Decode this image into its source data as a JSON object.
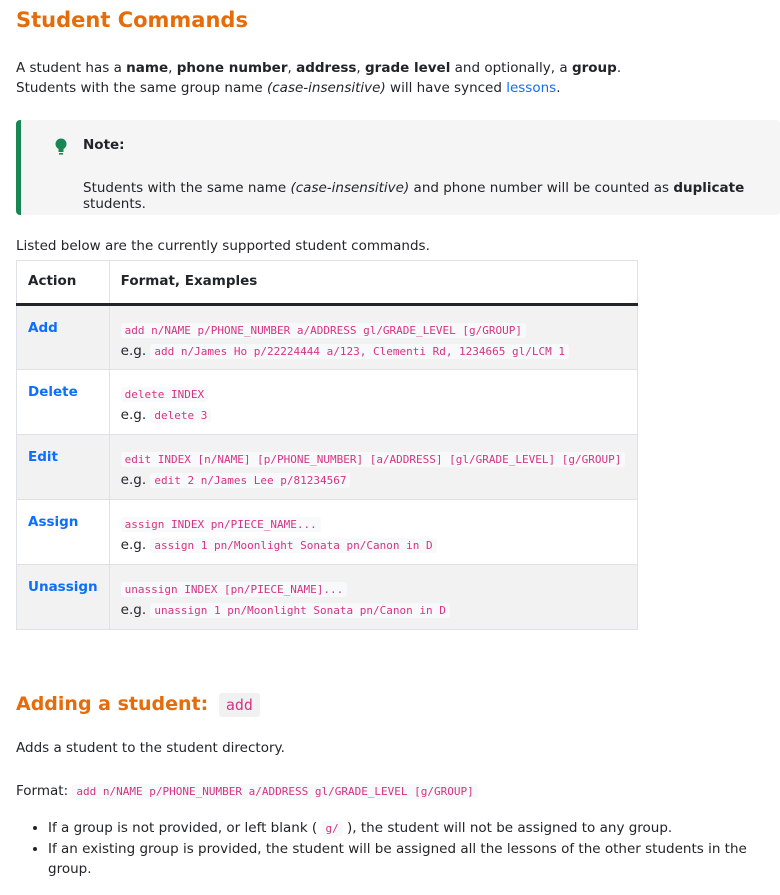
{
  "title": "Student Commands",
  "intro": {
    "p1_a": "A student has a ",
    "p1_name": "name",
    "p1_sep1": ", ",
    "p1_phone": "phone number",
    "p1_sep2": ", ",
    "p1_address": "address",
    "p1_sep3": ", ",
    "p1_grade": "grade level",
    "p1_b": " and optionally, a ",
    "p1_group": "group",
    "p1_c": ".",
    "p2_a": "Students with the same group name ",
    "p2_case": "(case-insensitive)",
    "p2_b": " will have synced ",
    "p2_link": "lessons",
    "p2_c": "."
  },
  "note": {
    "label": "Note:",
    "body_a": "Students with the same name ",
    "body_case": "(case-insensitive)",
    "body_b": " and phone number will be counted as ",
    "body_dup": "duplicate",
    "body_c": " students.",
    "icon_color": "#198754"
  },
  "listed_text": "Listed below are the currently supported student commands.",
  "table": {
    "headers": [
      "Action",
      "Format, Examples"
    ],
    "eg": "e.g.",
    "rows": [
      {
        "action": "Add",
        "format": "add n/NAME p/PHONE_NUMBER a/ADDRESS gl/GRADE_LEVEL [g/GROUP]",
        "example": "add n/James Ho p/22224444 a/123, Clementi Rd, 1234665 gl/LCM 1"
      },
      {
        "action": "Delete",
        "format": "delete INDEX",
        "example": "delete 3"
      },
      {
        "action": "Edit",
        "format": "edit INDEX [n/NAME] [p/PHONE_NUMBER] [a/ADDRESS] [gl/GRADE_LEVEL] [g/GROUP]",
        "example": "edit 2 n/James Lee p/81234567"
      },
      {
        "action": "Assign",
        "format": "assign INDEX pn/PIECE_NAME...",
        "example": "assign 1 pn/Moonlight Sonata pn/Canon in D"
      },
      {
        "action": "Unassign",
        "format": "unassign INDEX [pn/PIECE_NAME]...",
        "example": "unassign 1 pn/Moonlight Sonata pn/Canon in D"
      }
    ]
  },
  "add_section": {
    "heading": "Adding a student:",
    "heading_code": "add",
    "desc": "Adds a student to the student directory.",
    "format_label": "Format:",
    "format_code": "add n/NAME p/PHONE_NUMBER a/ADDRESS gl/GRADE_LEVEL [g/GROUP]",
    "bullet1_a": "If a group is not provided, or left blank ( ",
    "bullet1_code": "g/",
    "bullet1_b": " ), the student will not be assigned to any group.",
    "bullet2": "If an existing group is provided, the student will be assigned all the lessons of the other students in the group."
  },
  "colors": {
    "heading": "#e46c0a",
    "link": "#0d6efd",
    "code": "#d63384",
    "note_border": "#198754"
  }
}
